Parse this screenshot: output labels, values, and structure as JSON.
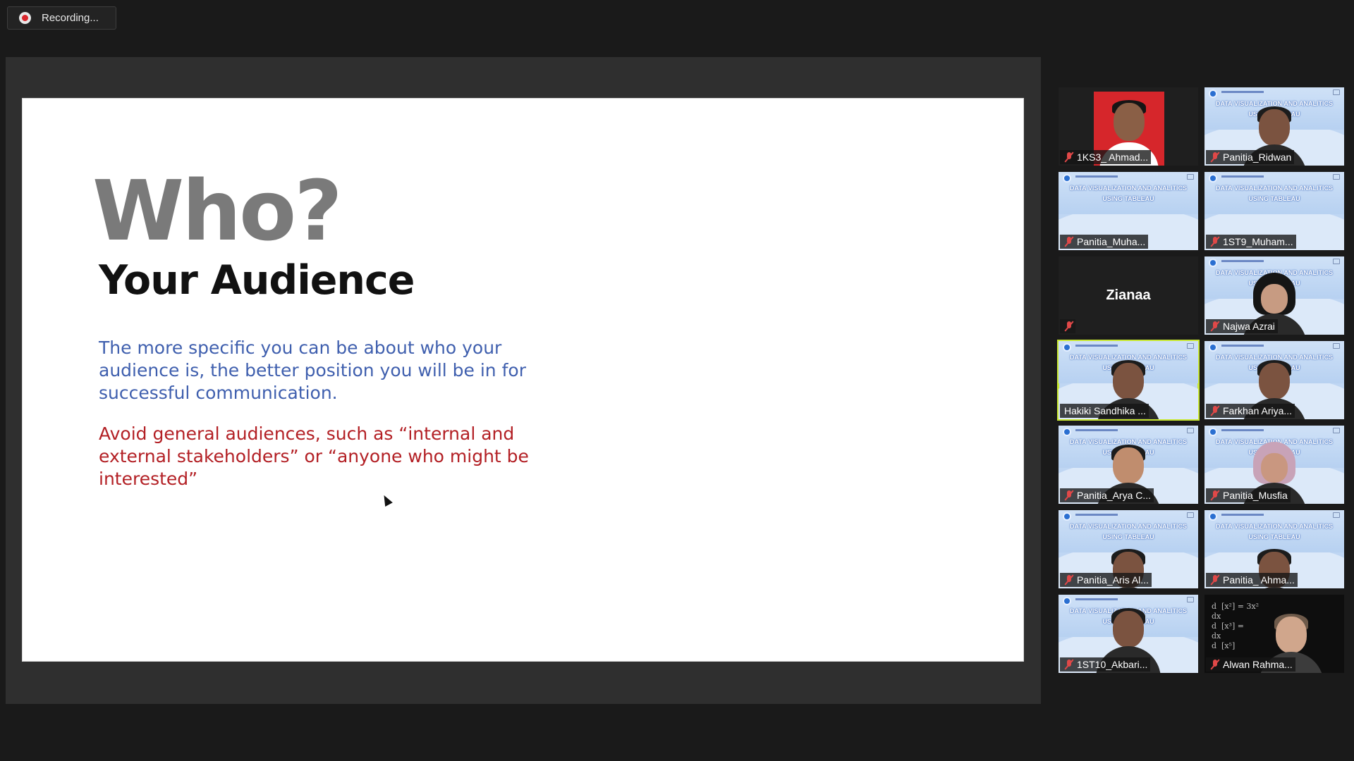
{
  "recording": {
    "label": "Recording..."
  },
  "slide": {
    "heading": "Who?",
    "subheading": "Your Audience",
    "paragraph1": "The more specific you can be about who your audience is, the better position you will be in for successful communication.",
    "paragraph2": "Avoid general audiences, such as “internal and external stakeholders” or “anyone who might be interested”"
  },
  "banner": {
    "line1": "DATA VISUALIZATION AND ANALITICS",
    "line2": "USING TABLEAU"
  },
  "colors": {
    "active_speaker_border": "#c9e832",
    "muted_mic": "#e04848",
    "slide_blue_text": "#3f5fae",
    "slide_red_text": "#b32025"
  },
  "participants": [
    {
      "name": "1KS3_ Ahmad...",
      "muted": true
    },
    {
      "name": "Panitia_Ridwan",
      "muted": true
    },
    {
      "name": "Panitia_Muha...",
      "muted": true
    },
    {
      "name": "1ST9_Muham...",
      "muted": true
    },
    {
      "name": "Zianaa",
      "muted": true,
      "camera_off": true
    },
    {
      "name": "Najwa Azrai",
      "muted": true
    },
    {
      "name": "Hakiki Sandhika ...",
      "muted": false,
      "active_speaker": true
    },
    {
      "name": "Farkhan Ariya...",
      "muted": true
    },
    {
      "name": "Panitia_Arya C...",
      "muted": true
    },
    {
      "name": "Panitia_Musfia",
      "muted": true
    },
    {
      "name": "Panitia_Aris Al...",
      "muted": true
    },
    {
      "name": "Panitia_ Ahma...",
      "muted": true
    },
    {
      "name": "1ST10_Akbari...",
      "muted": true
    },
    {
      "name": "Alwan Rahma...",
      "muted": true
    }
  ]
}
